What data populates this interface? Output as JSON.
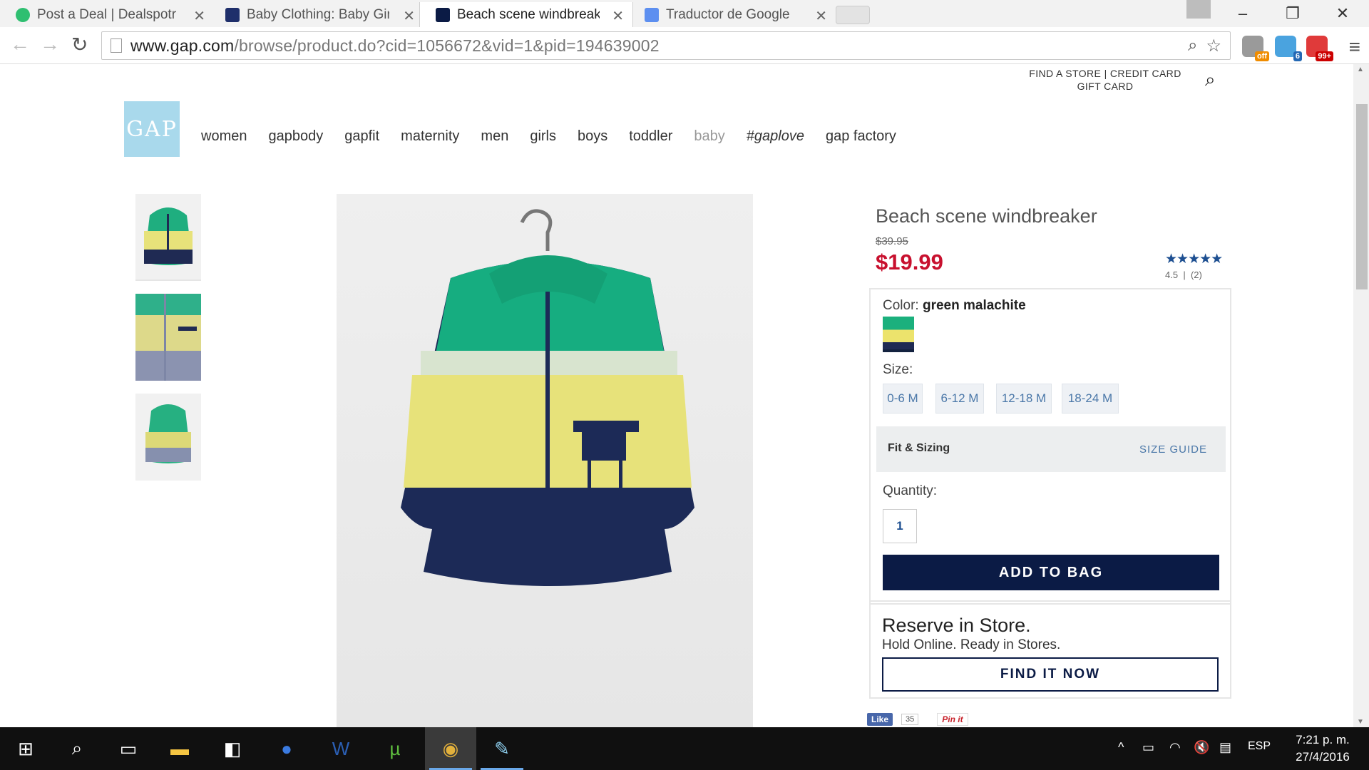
{
  "browser": {
    "tabs": [
      {
        "title": "Post a Deal | Dealspotr",
        "active": false
      },
      {
        "title": "Baby Clothing: Baby Girl C",
        "active": false
      },
      {
        "title": "Beach scene windbreaker",
        "active": true
      },
      {
        "title": "Traductor de Google",
        "active": false
      }
    ],
    "url_host": "www.gap.com",
    "url_path": "/browse/product.do?cid=1056672&vid=1&pid=194639002",
    "extensions": [
      {
        "name": "honey-extension",
        "badge": "off"
      },
      {
        "name": "ghostery-extension",
        "badge": "6"
      },
      {
        "name": "notifications-extension",
        "badge": "99+"
      }
    ]
  },
  "site": {
    "utility_links": {
      "line1": "FIND A STORE | CREDIT CARD",
      "line2": "GIFT CARD"
    },
    "logo_text": "GAP",
    "nav": [
      "women",
      "gapbody",
      "gapfit",
      "maternity",
      "men",
      "girls",
      "boys",
      "toddler",
      "baby",
      "#gaplove",
      "gap factory"
    ]
  },
  "product": {
    "title": "Beach scene windbreaker",
    "original_price": "$39.95",
    "sale_price": "$19.99",
    "stars": "★★★★★",
    "rating_value": "4.5",
    "rating_separator": "|",
    "review_count": "(2)",
    "color_label": "Color:",
    "color_value": "green malachite",
    "size_label": "Size:",
    "sizes": [
      "0-6 M",
      "6-12 M",
      "12-18 M",
      "18-24 M"
    ],
    "fit_label": "Fit & Sizing",
    "size_guide": "SIZE GUIDE",
    "quantity_label": "Quantity:",
    "quantity_value": "1",
    "add_to_bag": "ADD TO BAG",
    "reserve_title": "Reserve in Store.",
    "reserve_subtitle": "Hold Online. Ready in Stores.",
    "find_it_now": "FIND IT NOW",
    "fb_like": "Like",
    "fb_count": "35",
    "pinit": "Pin it"
  },
  "taskbar": {
    "language": "ESP",
    "time": "7:21 p. m.",
    "date": "27/4/2016"
  },
  "colors": {
    "sale_red": "#c8102e",
    "navy": "#0b1b45",
    "link_blue": "#4a77a8",
    "logo_blue": "#a9d9ec"
  }
}
